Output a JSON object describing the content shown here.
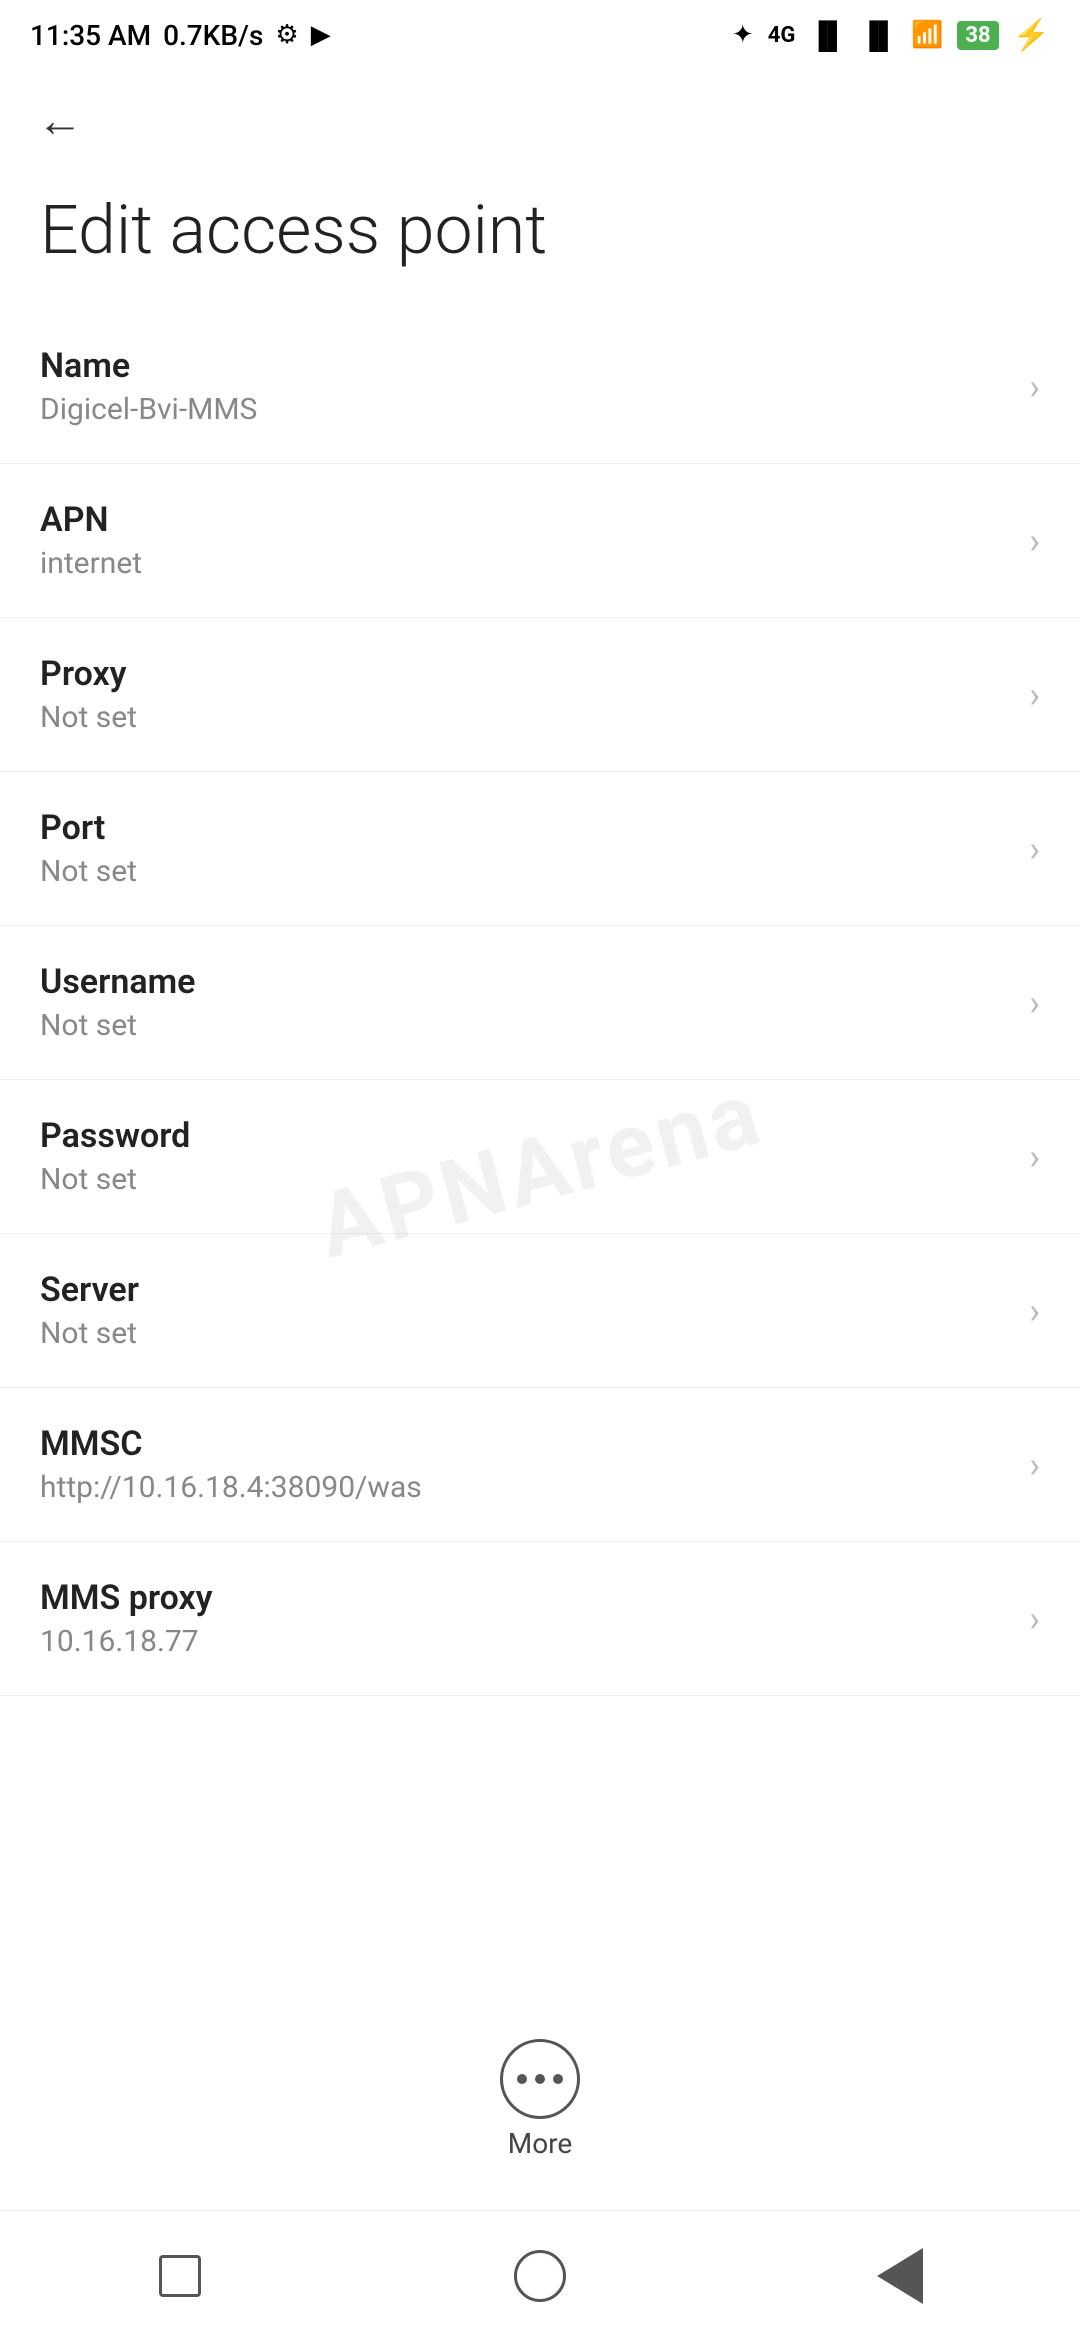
{
  "statusBar": {
    "time": "11:35 AM",
    "speed": "0.7KB/s"
  },
  "toolbar": {
    "backLabel": "←"
  },
  "page": {
    "title": "Edit access point"
  },
  "settings": [
    {
      "label": "Name",
      "value": "Digicel-Bvi-MMS"
    },
    {
      "label": "APN",
      "value": "internet"
    },
    {
      "label": "Proxy",
      "value": "Not set"
    },
    {
      "label": "Port",
      "value": "Not set"
    },
    {
      "label": "Username",
      "value": "Not set"
    },
    {
      "label": "Password",
      "value": "Not set"
    },
    {
      "label": "Server",
      "value": "Not set"
    },
    {
      "label": "MMSC",
      "value": "http://10.16.18.4:38090/was"
    },
    {
      "label": "MMS proxy",
      "value": "10.16.18.77"
    }
  ],
  "more": {
    "label": "More"
  },
  "watermark": "APNArena"
}
